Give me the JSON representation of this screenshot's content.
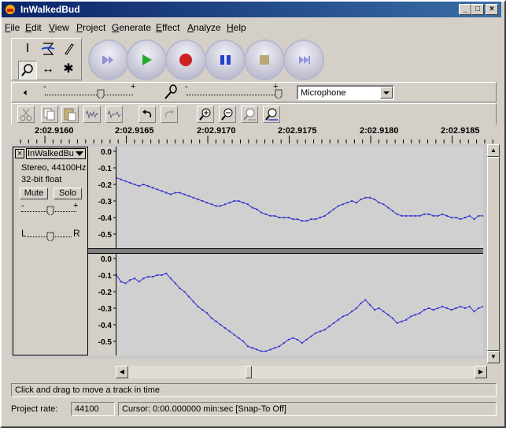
{
  "window": {
    "title": "InWalkedBud"
  },
  "menus": [
    {
      "label": "File",
      "key": "F",
      "rest": "ile"
    },
    {
      "label": "Edit",
      "key": "E",
      "rest": "dit"
    },
    {
      "label": "View",
      "key": "V",
      "rest": "iew"
    },
    {
      "label": "Project",
      "key": "P",
      "rest": "roject"
    },
    {
      "label": "Generate",
      "key": "G",
      "rest": "enerate"
    },
    {
      "label": "Effect",
      "key": "E",
      "rest": "ffect"
    },
    {
      "label": "Analyze",
      "key": "A",
      "rest": "nalyze"
    },
    {
      "label": "Help",
      "key": "H",
      "rest": "elp"
    }
  ],
  "mixer": {
    "input_source": "Microphone",
    "output_volume": 0.5,
    "input_volume": 1.0
  },
  "ruler": {
    "labels": [
      "2:02.9160",
      "2:02.9165",
      "2:02.9170",
      "2:02.9175",
      "2:02.9180",
      "2:02.9185"
    ]
  },
  "track": {
    "name": "InWalkedBu",
    "format": "Stereo, 44100Hz",
    "bit_depth": "32-bit float",
    "mute_label": "Mute",
    "solo_label": "Solo",
    "gain_minus": "-",
    "gain_plus": "+",
    "pan_left": "L",
    "pan_right": "R",
    "channel1_ticks": [
      "0.0",
      "-0.1",
      "-0.2",
      "-0.3",
      "-0.4",
      "-0.5"
    ],
    "channel2_ticks": [
      "0.0",
      "-0.1",
      "-0.2",
      "-0.3",
      "-0.4",
      "-0.5"
    ],
    "channel1_samples": [
      -0.16,
      -0.17,
      -0.18,
      -0.19,
      -0.2,
      -0.21,
      -0.2,
      -0.21,
      -0.22,
      -0.23,
      -0.24,
      -0.25,
      -0.26,
      -0.25,
      -0.25,
      -0.26,
      -0.27,
      -0.28,
      -0.29,
      -0.3,
      -0.31,
      -0.32,
      -0.33,
      -0.33,
      -0.32,
      -0.31,
      -0.3,
      -0.3,
      -0.31,
      -0.32,
      -0.34,
      -0.35,
      -0.37,
      -0.38,
      -0.39,
      -0.39,
      -0.4,
      -0.4,
      -0.4,
      -0.41,
      -0.41,
      -0.42,
      -0.42,
      -0.41,
      -0.41,
      -0.4,
      -0.39,
      -0.37,
      -0.35,
      -0.33,
      -0.32,
      -0.31,
      -0.3,
      -0.31,
      -0.29,
      -0.28,
      -0.28,
      -0.29,
      -0.31,
      -0.32,
      -0.34,
      -0.36,
      -0.38,
      -0.39,
      -0.39,
      -0.39,
      -0.39,
      -0.39,
      -0.38,
      -0.38,
      -0.39,
      -0.39,
      -0.38,
      -0.39,
      -0.4,
      -0.4,
      -0.41,
      -0.4,
      -0.39,
      -0.41,
      -0.39,
      -0.39
    ],
    "channel2_samples": [
      -0.1,
      -0.14,
      -0.15,
      -0.13,
      -0.12,
      -0.14,
      -0.12,
      -0.11,
      -0.11,
      -0.1,
      -0.1,
      -0.09,
      -0.12,
      -0.15,
      -0.18,
      -0.2,
      -0.23,
      -0.26,
      -0.29,
      -0.31,
      -0.33,
      -0.36,
      -0.38,
      -0.4,
      -0.42,
      -0.44,
      -0.46,
      -0.48,
      -0.5,
      -0.53,
      -0.54,
      -0.55,
      -0.56,
      -0.56,
      -0.55,
      -0.54,
      -0.53,
      -0.51,
      -0.49,
      -0.48,
      -0.49,
      -0.51,
      -0.49,
      -0.47,
      -0.45,
      -0.44,
      -0.43,
      -0.41,
      -0.39,
      -0.37,
      -0.35,
      -0.34,
      -0.32,
      -0.3,
      -0.27,
      -0.25,
      -0.28,
      -0.31,
      -0.3,
      -0.32,
      -0.34,
      -0.36,
      -0.39,
      -0.38,
      -0.37,
      -0.35,
      -0.34,
      -0.33,
      -0.31,
      -0.3,
      -0.31,
      -0.3,
      -0.29,
      -0.3,
      -0.31,
      -0.3,
      -0.29,
      -0.3,
      -0.29,
      -0.32,
      -0.3,
      -0.29
    ]
  },
  "status": {
    "message": "Click and drag to move a track in time"
  },
  "bottom": {
    "project_rate_label": "Project rate:",
    "project_rate": "44100",
    "cursor": "Cursor: 0:00.000000 min:sec   [Snap-To Off]"
  },
  "colors": {
    "waveform": "#3333cc",
    "titlebar": "#0a246a",
    "play": "#22aa33",
    "record": "#cc2222",
    "pause": "#2244cc",
    "stop": "#b8a878"
  }
}
